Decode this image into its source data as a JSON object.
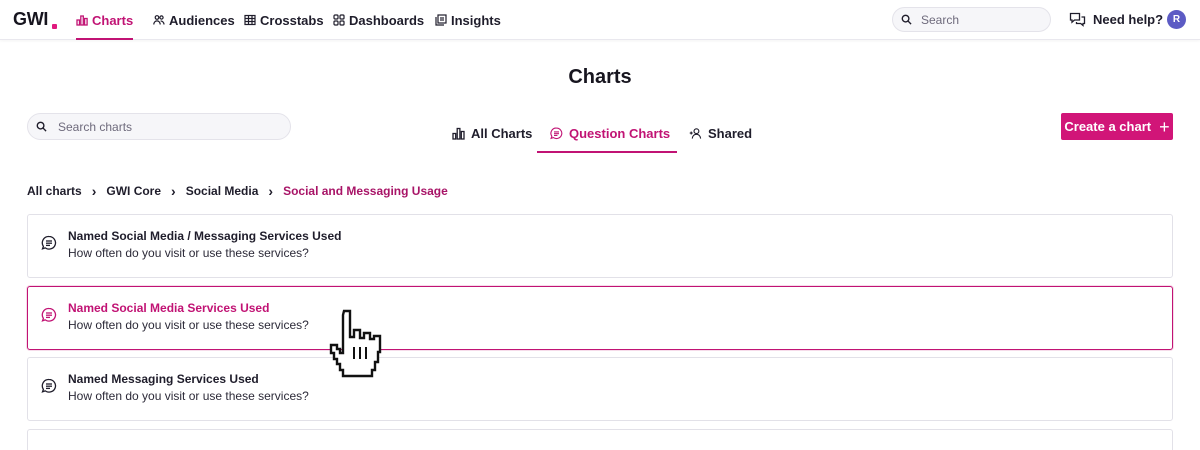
{
  "app": {
    "logo": "GWI"
  },
  "nav": {
    "items": [
      {
        "label": "Charts",
        "icon": "bar-chart-icon",
        "active": true
      },
      {
        "label": "Audiences",
        "icon": "people-icon",
        "active": false
      },
      {
        "label": "Crosstabs",
        "icon": "table-icon",
        "active": false
      },
      {
        "label": "Dashboards",
        "icon": "grid-icon",
        "active": false
      },
      {
        "label": "Insights",
        "icon": "pages-icon",
        "active": false
      }
    ],
    "search_placeholder": "Search",
    "help_label": "Need help?",
    "avatar_initial": "R"
  },
  "page": {
    "title": "Charts",
    "search_placeholder": "Search charts",
    "tabs": [
      {
        "label": "All Charts",
        "icon": "bar-chart-icon",
        "active": false
      },
      {
        "label": "Question Charts",
        "icon": "question-bubble-icon",
        "active": true
      },
      {
        "label": "Shared",
        "icon": "share-user-icon",
        "active": false
      }
    ],
    "create_label": "Create a chart",
    "create_icon": "plus-icon"
  },
  "breadcrumb": {
    "items": [
      "All charts",
      "GWI Core",
      "Social Media",
      "Social and Messaging Usage"
    ]
  },
  "charts": [
    {
      "title": "Named Social Media / Messaging Services Used",
      "subtitle": "How often do you visit or use these services?",
      "hovered": false
    },
    {
      "title": "Named Social Media Services Used",
      "subtitle": "How often do you visit or use these services?",
      "hovered": true
    },
    {
      "title": "Named Messaging Services Used",
      "subtitle": "How often do you visit or use these services?",
      "hovered": false
    }
  ],
  "colors": {
    "brand": "#c11374",
    "button": "#d11578",
    "avatar": "#5c5bc4"
  }
}
